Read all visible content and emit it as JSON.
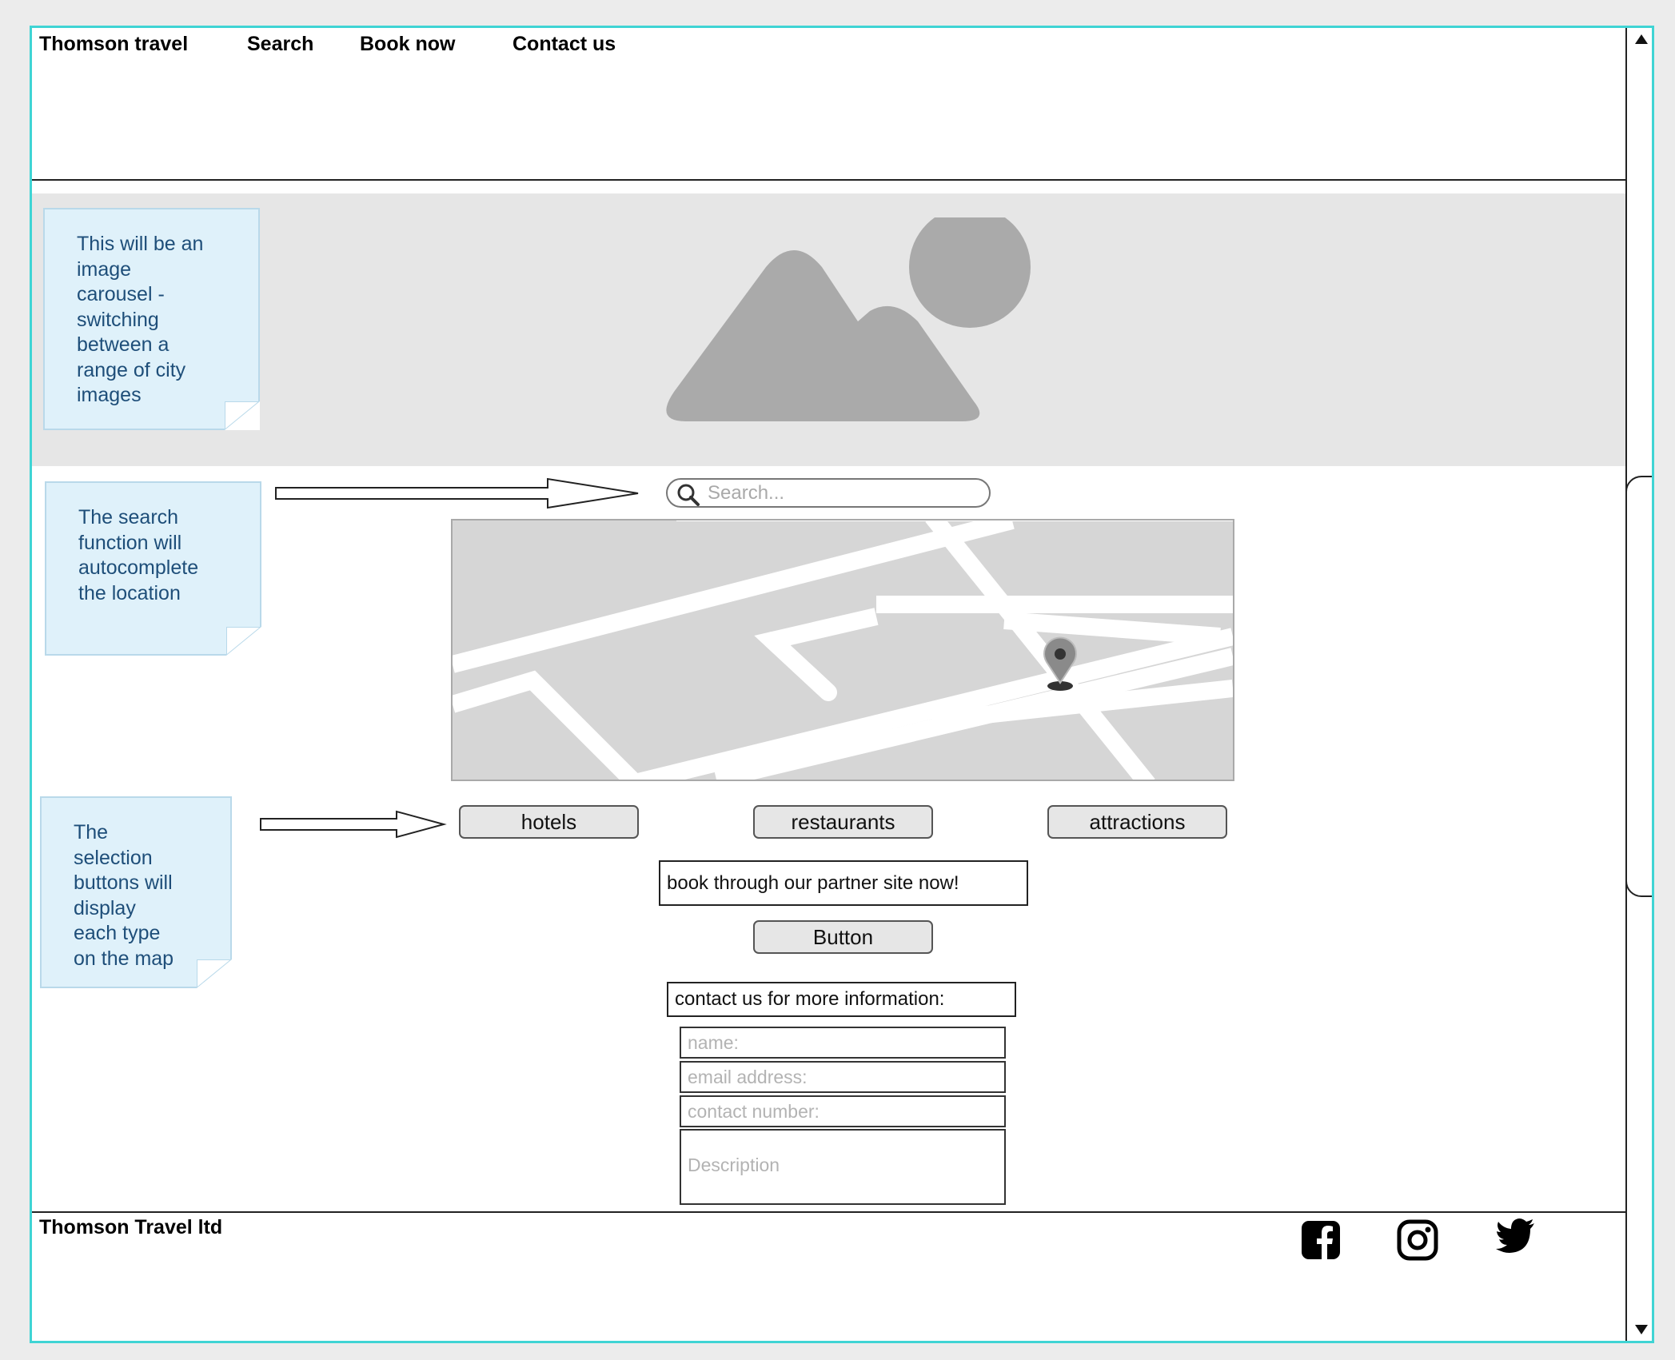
{
  "nav": {
    "brand": "Thomson travel",
    "items": [
      "Search",
      "Book now",
      "Contact us"
    ]
  },
  "notes": {
    "carousel": [
      "This will be an",
      "image",
      "carousel -",
      "switching",
      "between a",
      "range of city",
      "images"
    ],
    "search": [
      "The search",
      "function will",
      "autocomplete",
      "the location"
    ],
    "selection": [
      "The",
      "selection",
      "buttons will",
      "display",
      "each type",
      "on the map"
    ]
  },
  "search": {
    "placeholder": "Search..."
  },
  "categories": [
    "hotels",
    "restaurants",
    "attractions"
  ],
  "partner": {
    "text": "book through our partner site now!",
    "button": "Button"
  },
  "contact": {
    "heading": "contact us for more information:",
    "name_placeholder": "name:",
    "email_placeholder": "email address:",
    "phone_placeholder": "contact number:",
    "description_placeholder": "Description"
  },
  "footer": {
    "company": "Thomson Travel ltd",
    "social": [
      "facebook-icon",
      "instagram-icon",
      "twitter-icon"
    ]
  },
  "colors": {
    "frame_border": "#3fd4d4",
    "note_bg": "#dff1fa",
    "note_text": "#1e4e79"
  }
}
